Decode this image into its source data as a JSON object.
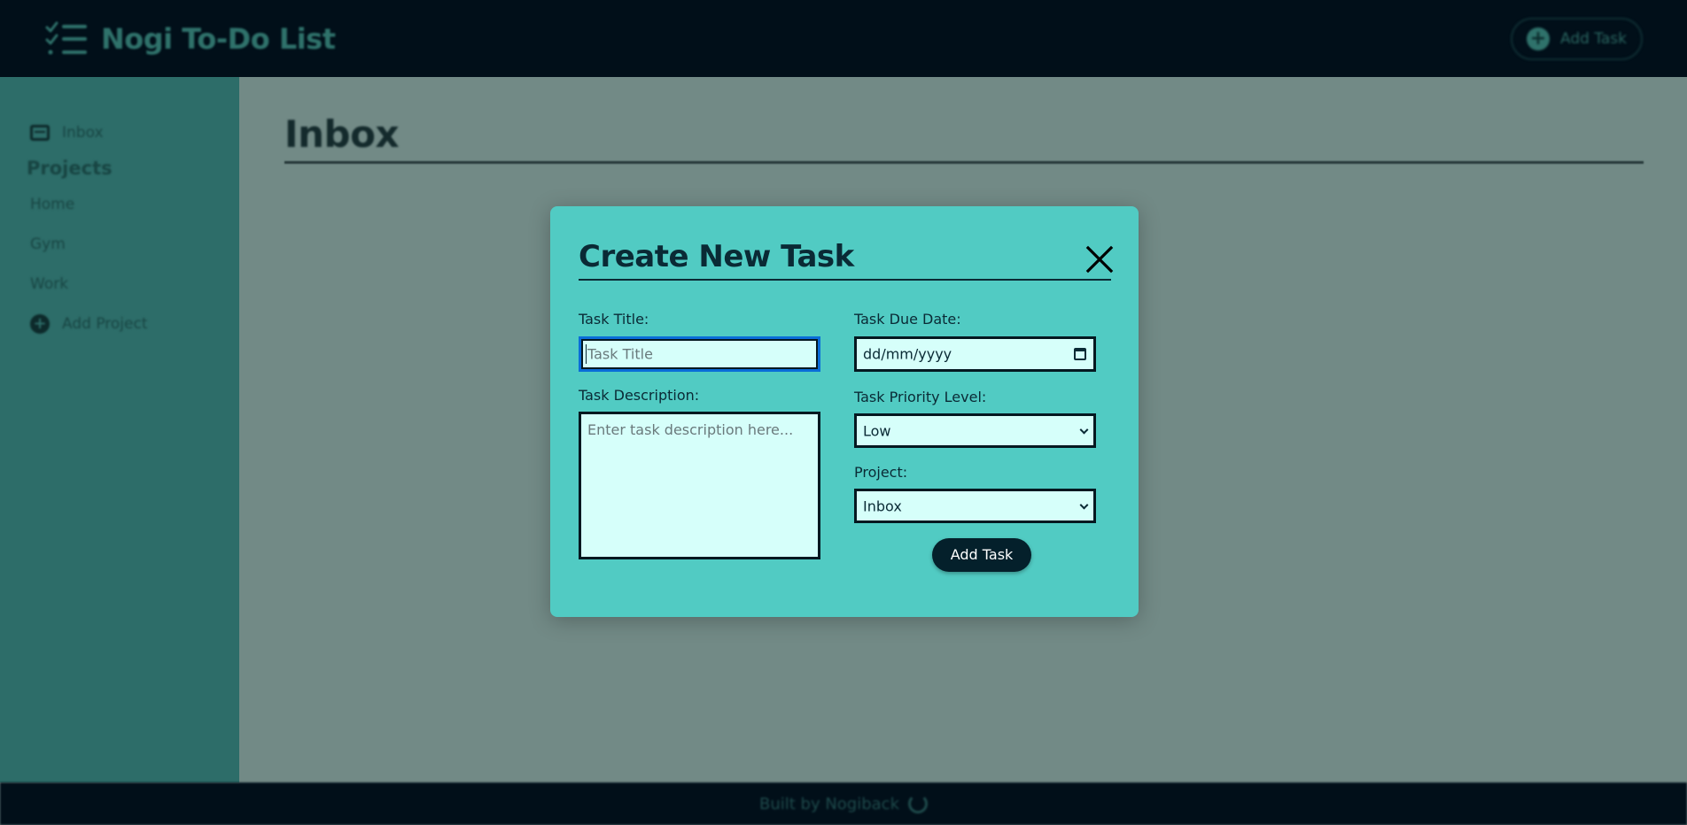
{
  "header": {
    "app_title": "Nogi To-Do List",
    "logo_icon": "checklist-icon",
    "add_task_label": "Add Task"
  },
  "sidebar": {
    "inbox_label": "Inbox",
    "projects_heading": "Projects",
    "projects": [
      {
        "label": "Home"
      },
      {
        "label": "Gym"
      },
      {
        "label": "Work"
      }
    ],
    "add_project_label": "Add Project"
  },
  "main": {
    "title": "Inbox"
  },
  "modal": {
    "title": "Create New Task",
    "close_icon": "close-icon",
    "task_title": {
      "label": "Task Title:",
      "value": "",
      "placeholder": "Task Title"
    },
    "task_description": {
      "label": "Task Description:",
      "value": "",
      "placeholder": "Enter task description here..."
    },
    "due_date": {
      "label": "Task Due Date:",
      "value": "dd/mm/yyyy"
    },
    "priority": {
      "label": "Task Priority Level:",
      "value": "Low"
    },
    "project": {
      "label": "Project:",
      "value": "Inbox"
    },
    "submit_label": "Add Task"
  },
  "footer": {
    "credit": "Built by Nogiback"
  },
  "colors": {
    "header_bg": "#010f19",
    "sidebar_bg": "#2d6d69",
    "overlay_bg": "#728a86",
    "modal_bg": "#51cbc3",
    "field_bg": "#d6fffa",
    "button_bg": "#04202b",
    "focus_ring": "#0a6dd8"
  }
}
